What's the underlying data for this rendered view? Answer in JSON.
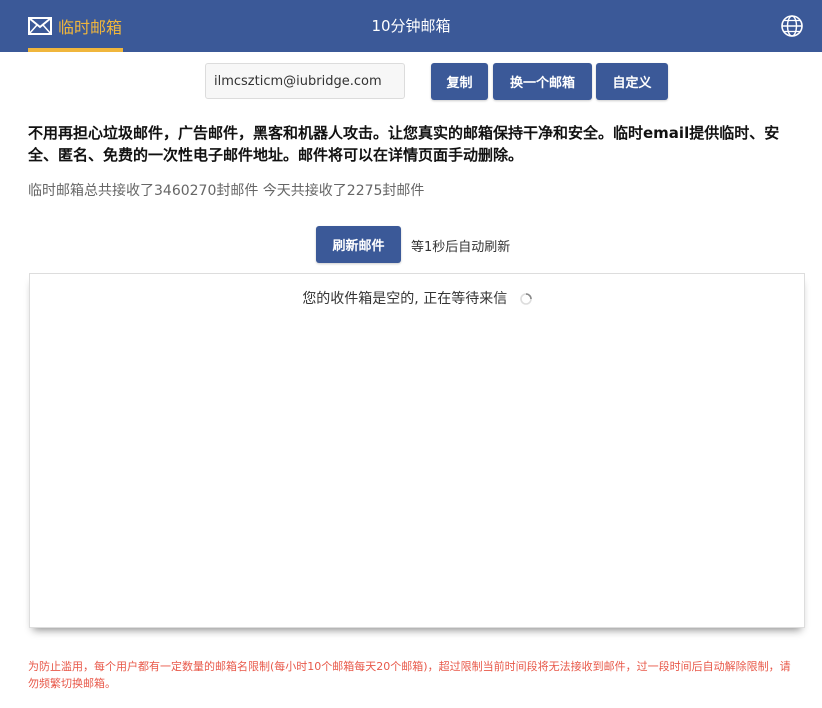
{
  "nav": {
    "brand_label": "临时邮箱",
    "title": "10分钟邮箱",
    "brand_icon": "envelope-icon",
    "language_icon": "globe-icon",
    "brand_color": "#f0b63c",
    "bar_color": "#3b5998"
  },
  "email": {
    "address": "ilmcszticm@iubridge.com",
    "copy_label": "复制",
    "change_label": "换一个邮箱",
    "custom_label": "自定义"
  },
  "intro": {
    "description": "不用再担心垃圾邮件，广告邮件，黑客和机器人攻击。让您真实的邮箱保持干净和安全。临时email提供临时、安全、匿名、免费的一次性电子邮件地址。邮件将可以在详情页面手动删除。",
    "stats": "临时邮箱总共接收了3460270封邮件 今天共接收了2275封邮件"
  },
  "refresh": {
    "button_label": "刷新邮件",
    "auto_text": "等1秒后自动刷新"
  },
  "inbox": {
    "empty_message": "您的收件箱是空的, 正在等待来信",
    "spinner_icon": "loading-spinner-icon"
  },
  "footer": {
    "notice": "为防止滥用，每个用户都有一定数量的邮箱名限制(每小时10个邮箱每天20个邮箱)，超过限制当前时间段将无法接收到邮件，过一段时间后自动解除限制，请勿频繁切换邮箱。",
    "notice_color": "#e8594a"
  }
}
